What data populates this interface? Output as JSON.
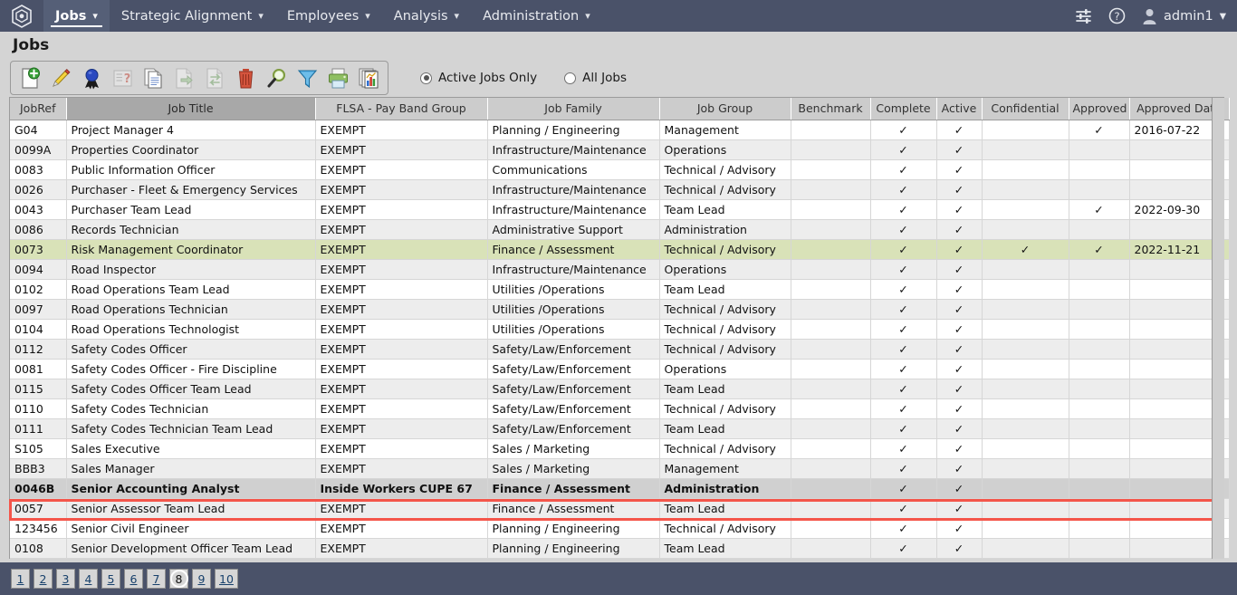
{
  "nav": {
    "logo_icon": "hexagon-logo-icon",
    "items": [
      {
        "label": "Jobs",
        "active": true
      },
      {
        "label": "Strategic Alignment",
        "active": false
      },
      {
        "label": "Employees",
        "active": false
      },
      {
        "label": "Analysis",
        "active": false
      },
      {
        "label": "Administration",
        "active": false
      }
    ],
    "settings_icon": "sliders-icon",
    "help_icon": "question-circle-icon",
    "user_icon": "user-avatar-icon",
    "user_label": "admin1",
    "caret": "⌄"
  },
  "page": {
    "title": "Jobs"
  },
  "toolbar": {
    "buttons": [
      {
        "name": "new-job-button",
        "icon": "page-add-icon",
        "disabled": false
      },
      {
        "name": "edit-job-button",
        "icon": "pencil-edit-icon",
        "disabled": false
      },
      {
        "name": "approve-job-button",
        "icon": "award-ribbon-icon",
        "disabled": false
      },
      {
        "name": "questionnaire-button",
        "icon": "form-question-icon",
        "disabled": true
      },
      {
        "name": "copy-job-button",
        "icon": "document-copy-icon",
        "disabled": false
      },
      {
        "name": "export-job-button",
        "icon": "page-export-arrow-icon",
        "disabled": true
      },
      {
        "name": "transfer-job-button",
        "icon": "page-transfer-arrow-icon",
        "disabled": true
      },
      {
        "name": "delete-job-button",
        "icon": "trash-can-icon",
        "disabled": false
      },
      {
        "name": "search-button",
        "icon": "magnifier-icon",
        "disabled": false
      },
      {
        "name": "filter-button",
        "icon": "funnel-filter-icon",
        "disabled": false
      },
      {
        "name": "print-button",
        "icon": "printer-icon",
        "disabled": false
      },
      {
        "name": "reports-button",
        "icon": "charts-reports-icon",
        "disabled": false
      }
    ]
  },
  "filters": {
    "active_only": {
      "label": "Active Jobs Only",
      "checked": true
    },
    "all_jobs": {
      "label": "All Jobs",
      "checked": false
    }
  },
  "table": {
    "columns": [
      {
        "label": "JobRef",
        "sorted": false
      },
      {
        "label": "Job Title",
        "sorted": true
      },
      {
        "label": "FLSA - Pay Band Group",
        "sorted": false
      },
      {
        "label": "Job Family",
        "sorted": false
      },
      {
        "label": "Job Group",
        "sorted": false
      },
      {
        "label": "Benchmark",
        "sorted": false
      },
      {
        "label": "Complete",
        "sorted": false
      },
      {
        "label": "Active",
        "sorted": false
      },
      {
        "label": "Confidential",
        "sorted": false
      },
      {
        "label": "Approved",
        "sorted": false
      },
      {
        "label": "Approved Date",
        "sorted": false
      }
    ],
    "check_glyph": "✓",
    "rows": [
      {
        "jobref": "G04",
        "title": "Project Manager 4",
        "flsa": "EXEMPT",
        "family": "Planning / Engineering",
        "group": "Management",
        "benchmark": "",
        "complete": true,
        "active": true,
        "confidential": false,
        "approved": true,
        "approved_date": "2016-07-22",
        "state": "normal"
      },
      {
        "jobref": "0099A",
        "title": "Properties Coordinator",
        "flsa": "EXEMPT",
        "family": "Infrastructure/Maintenance",
        "group": "Operations",
        "benchmark": "",
        "complete": true,
        "active": true,
        "confidential": false,
        "approved": false,
        "approved_date": "",
        "state": "alt"
      },
      {
        "jobref": "0083",
        "title": "Public Information Officer",
        "flsa": "EXEMPT",
        "family": "Communications",
        "group": "Technical / Advisory",
        "benchmark": "",
        "complete": true,
        "active": true,
        "confidential": false,
        "approved": false,
        "approved_date": "",
        "state": "normal"
      },
      {
        "jobref": "0026",
        "title": "Purchaser - Fleet & Emergency Services",
        "flsa": "EXEMPT",
        "family": "Infrastructure/Maintenance",
        "group": "Technical / Advisory",
        "benchmark": "",
        "complete": true,
        "active": true,
        "confidential": false,
        "approved": false,
        "approved_date": "",
        "state": "alt"
      },
      {
        "jobref": "0043",
        "title": "Purchaser Team Lead",
        "flsa": "EXEMPT",
        "family": "Infrastructure/Maintenance",
        "group": "Team Lead",
        "benchmark": "",
        "complete": true,
        "active": true,
        "confidential": false,
        "approved": true,
        "approved_date": "2022-09-30",
        "state": "normal"
      },
      {
        "jobref": "0086",
        "title": "Records Technician",
        "flsa": "EXEMPT",
        "family": "Administrative Support",
        "group": "Administration",
        "benchmark": "",
        "complete": true,
        "active": true,
        "confidential": false,
        "approved": false,
        "approved_date": "",
        "state": "alt"
      },
      {
        "jobref": "0073",
        "title": "Risk Management Coordinator",
        "flsa": "EXEMPT",
        "family": "Finance / Assessment",
        "group": "Technical / Advisory",
        "benchmark": "",
        "complete": true,
        "active": true,
        "confidential": true,
        "approved": true,
        "approved_date": "2022-11-21",
        "state": "green"
      },
      {
        "jobref": "0094",
        "title": "Road Inspector",
        "flsa": "EXEMPT",
        "family": "Infrastructure/Maintenance",
        "group": "Operations",
        "benchmark": "",
        "complete": true,
        "active": true,
        "confidential": false,
        "approved": false,
        "approved_date": "",
        "state": "alt"
      },
      {
        "jobref": "0102",
        "title": "Road Operations Team Lead",
        "flsa": "EXEMPT",
        "family": "Utilities /Operations",
        "group": "Team Lead",
        "benchmark": "",
        "complete": true,
        "active": true,
        "confidential": false,
        "approved": false,
        "approved_date": "",
        "state": "normal"
      },
      {
        "jobref": "0097",
        "title": "Road Operations Technician",
        "flsa": "EXEMPT",
        "family": "Utilities /Operations",
        "group": "Technical / Advisory",
        "benchmark": "",
        "complete": true,
        "active": true,
        "confidential": false,
        "approved": false,
        "approved_date": "",
        "state": "alt"
      },
      {
        "jobref": "0104",
        "title": "Road Operations Technologist",
        "flsa": "EXEMPT",
        "family": "Utilities /Operations",
        "group": "Technical / Advisory",
        "benchmark": "",
        "complete": true,
        "active": true,
        "confidential": false,
        "approved": false,
        "approved_date": "",
        "state": "normal"
      },
      {
        "jobref": "0112",
        "title": "Safety Codes Officer",
        "flsa": "EXEMPT",
        "family": "Safety/Law/Enforcement",
        "group": "Technical / Advisory",
        "benchmark": "",
        "complete": true,
        "active": true,
        "confidential": false,
        "approved": false,
        "approved_date": "",
        "state": "alt"
      },
      {
        "jobref": "0081",
        "title": "Safety Codes Officer - Fire Discipline",
        "flsa": "EXEMPT",
        "family": "Safety/Law/Enforcement",
        "group": "Operations",
        "benchmark": "",
        "complete": true,
        "active": true,
        "confidential": false,
        "approved": false,
        "approved_date": "",
        "state": "normal"
      },
      {
        "jobref": "0115",
        "title": "Safety Codes Officer Team Lead",
        "flsa": "EXEMPT",
        "family": "Safety/Law/Enforcement",
        "group": "Team Lead",
        "benchmark": "",
        "complete": true,
        "active": true,
        "confidential": false,
        "approved": false,
        "approved_date": "",
        "state": "alt"
      },
      {
        "jobref": "0110",
        "title": "Safety Codes Technician",
        "flsa": "EXEMPT",
        "family": "Safety/Law/Enforcement",
        "group": "Technical / Advisory",
        "benchmark": "",
        "complete": true,
        "active": true,
        "confidential": false,
        "approved": false,
        "approved_date": "",
        "state": "normal"
      },
      {
        "jobref": "0111",
        "title": "Safety Codes Technician Team Lead",
        "flsa": "EXEMPT",
        "family": "Safety/Law/Enforcement",
        "group": "Team Lead",
        "benchmark": "",
        "complete": true,
        "active": true,
        "confidential": false,
        "approved": false,
        "approved_date": "",
        "state": "alt"
      },
      {
        "jobref": "S105",
        "title": "Sales Executive",
        "flsa": "EXEMPT",
        "family": "Sales / Marketing",
        "group": "Technical / Advisory",
        "benchmark": "",
        "complete": true,
        "active": true,
        "confidential": false,
        "approved": false,
        "approved_date": "",
        "state": "normal"
      },
      {
        "jobref": "BBB3",
        "title": "Sales Manager",
        "flsa": "EXEMPT",
        "family": "Sales / Marketing",
        "group": "Management",
        "benchmark": "",
        "complete": true,
        "active": true,
        "confidential": false,
        "approved": false,
        "approved_date": "",
        "state": "alt"
      },
      {
        "jobref": "0046B",
        "title": "Senior Accounting Analyst",
        "flsa": "Inside Workers CUPE 67",
        "family": "Finance / Assessment",
        "group": "Administration",
        "benchmark": "",
        "complete": true,
        "active": true,
        "confidential": false,
        "approved": false,
        "approved_date": "",
        "state": "selected"
      },
      {
        "jobref": "0057",
        "title": "Senior Assessor Team Lead",
        "flsa": "EXEMPT",
        "family": "Finance / Assessment",
        "group": "Team Lead",
        "benchmark": "",
        "complete": true,
        "active": true,
        "confidential": false,
        "approved": false,
        "approved_date": "",
        "state": "alt"
      },
      {
        "jobref": "123456",
        "title": "Senior Civil Engineer",
        "flsa": "EXEMPT",
        "family": "Planning / Engineering",
        "group": "Technical / Advisory",
        "benchmark": "",
        "complete": true,
        "active": true,
        "confidential": false,
        "approved": false,
        "approved_date": "",
        "state": "normal"
      },
      {
        "jobref": "0108",
        "title": "Senior Development Officer Team Lead",
        "flsa": "EXEMPT",
        "family": "Planning / Engineering",
        "group": "Team Lead",
        "benchmark": "",
        "complete": true,
        "active": true,
        "confidential": false,
        "approved": false,
        "approved_date": "",
        "state": "alt"
      }
    ]
  },
  "pagination": {
    "pages": [
      "1",
      "2",
      "3",
      "4",
      "5",
      "6",
      "7",
      "8",
      "9",
      "10"
    ],
    "current": "8"
  },
  "colors": {
    "navbar": "#4a5269",
    "nav_active": "#555f77",
    "selected_outline": "#f4554a",
    "highlight_row": "#d9e2b8",
    "header": "#cccccc",
    "sorted_header": "#a8a8a8"
  }
}
